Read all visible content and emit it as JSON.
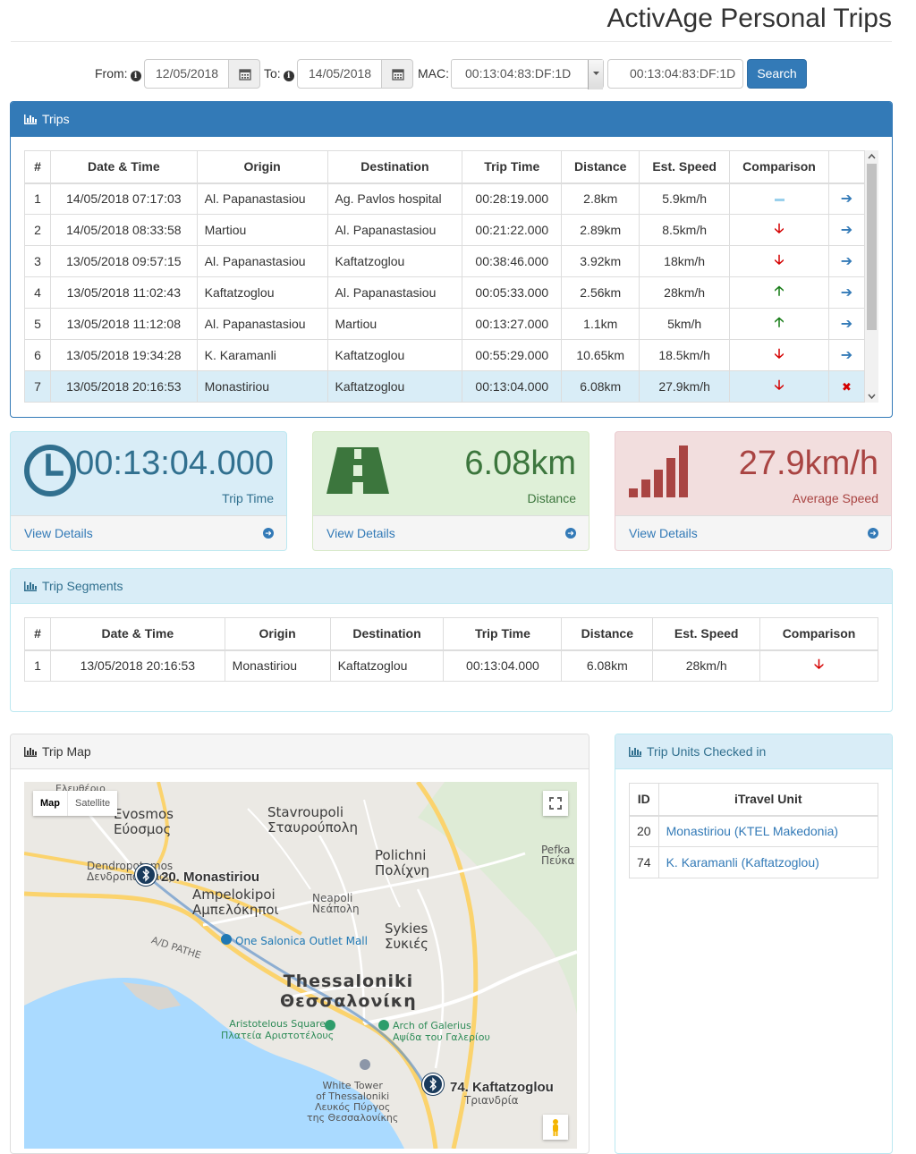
{
  "app": {
    "title": "ActivAge Personal Trips"
  },
  "search": {
    "from_label": "From:",
    "from_value": "12/05/2018",
    "to_label": "To:",
    "to_value": "14/05/2018",
    "mac_label": "MAC:",
    "mac_selected": "00:13:04:83:DF:1D",
    "mac_input_value": "00:13:04:83:DF:1D",
    "search_button": "Search"
  },
  "trips": {
    "title": "Trips",
    "columns": [
      "#",
      "Date & Time",
      "Origin",
      "Destination",
      "Trip Time",
      "Distance",
      "Est. Speed",
      "Comparison",
      ""
    ],
    "rows": [
      {
        "num": "1",
        "datetime": "14/05/2018 07:17:03",
        "origin": "Al. Papanastasiou",
        "destination": "Ag. Pavlos hospital",
        "trip_time": "00:28:19.000",
        "distance": "2.8km",
        "speed": "5.9km/h",
        "comparison": "neutral",
        "action": "arrow-right"
      },
      {
        "num": "2",
        "datetime": "14/05/2018 08:33:58",
        "origin": "Martiou",
        "destination": "Al. Papanastasiou",
        "trip_time": "00:21:22.000",
        "distance": "2.89km",
        "speed": "8.5km/h",
        "comparison": "down",
        "action": "arrow-right"
      },
      {
        "num": "3",
        "datetime": "13/05/2018 09:57:15",
        "origin": "Al. Papanastasiou",
        "destination": "Kaftatzoglou",
        "trip_time": "00:38:46.000",
        "distance": "3.92km",
        "speed": "18km/h",
        "comparison": "down",
        "action": "arrow-right"
      },
      {
        "num": "4",
        "datetime": "13/05/2018 11:02:43",
        "origin": "Kaftatzoglou",
        "destination": "Al. Papanastasiou",
        "trip_time": "00:05:33.000",
        "distance": "2.56km",
        "speed": "28km/h",
        "comparison": "up",
        "action": "arrow-right"
      },
      {
        "num": "5",
        "datetime": "13/05/2018 11:12:08",
        "origin": "Al. Papanastasiou",
        "destination": "Martiou",
        "trip_time": "00:13:27.000",
        "distance": "1.1km",
        "speed": "5km/h",
        "comparison": "up",
        "action": "arrow-right"
      },
      {
        "num": "6",
        "datetime": "13/05/2018 19:34:28",
        "origin": "K. Karamanli",
        "destination": "Kaftatzoglou",
        "trip_time": "00:55:29.000",
        "distance": "10.65km",
        "speed": "18.5km/h",
        "comparison": "down",
        "action": "arrow-right"
      },
      {
        "num": "7",
        "datetime": "13/05/2018 20:16:53",
        "origin": "Monastiriou",
        "destination": "Kaftatzoglou",
        "trip_time": "00:13:04.000",
        "distance": "6.08km",
        "speed": "27.9km/h",
        "comparison": "down",
        "action": "close"
      }
    ]
  },
  "stats": {
    "trip_time": {
      "value": "00:13:04.000",
      "caption": "Trip Time",
      "link": "View Details",
      "icon": "clock-icon",
      "bg": "#d9edf7",
      "border": "#bce8f1",
      "color": "#31708f"
    },
    "distance": {
      "value": "6.08km",
      "caption": "Distance",
      "link": "View Details",
      "icon": "road-icon",
      "bg": "#dff0d8",
      "border": "#d6e9c6",
      "color": "#3c763d"
    },
    "speed": {
      "value": "27.9km/h",
      "caption": "Average Speed",
      "link": "View Details",
      "icon": "signal-bars-icon",
      "bg": "#f2dede",
      "border": "#ebccd1",
      "color": "#a94442"
    }
  },
  "segments": {
    "title": "Trip Segments",
    "columns": [
      "#",
      "Date & Time",
      "Origin",
      "Destination",
      "Trip Time",
      "Distance",
      "Est. Speed",
      "Comparison"
    ],
    "rows": [
      {
        "num": "1",
        "datetime": "13/05/2018 20:16:53",
        "origin": "Monastiriou",
        "destination": "Kaftatzoglou",
        "trip_time": "00:13:04.000",
        "distance": "6.08km",
        "speed": "28km/h",
        "comparison": "down"
      }
    ]
  },
  "map": {
    "title": "Trip Map",
    "type_map": "Map",
    "type_satellite": "Satellite",
    "labels": {
      "evosmos": "Evosmos\nΕύοσμος",
      "stavroupoli": "Stavroupoli\nΣταυρούπολη",
      "polichni": "Polichni\nΠολίχνη",
      "pefka": "Pefka\nΠεύκα",
      "dendropotamos": "Dendropotamos\nΔενδροπόταμος",
      "ampelokipoi": "Ampelokipoi\nΑμπελόκηποι",
      "neapoli": "Neapoli\nΝεάπολη",
      "sykies": "Sykies\nΣυκιές",
      "thessaloniki": "Thessaloniki\nΘεσσαλονίκη",
      "one_salonica": "One Salonica Outlet Mall",
      "aristotelous": "Aristotelous Square\nΠλατεία Αριστοτέλους",
      "galerius": "Arch of Galerius\nΑψίδα του Γαλερίου",
      "white_tower": "White Tower\nof Thessaloniki\nΛευκός Πύργος\nτης Θεσσαλονίκης",
      "triandria": "Τριανδρία",
      "eleftherio": "Ελευθέριο",
      "ad_pathe": "A/D PATHE"
    },
    "markers": [
      {
        "label": "20. Monastiriou",
        "icon": "bluetooth-icon"
      },
      {
        "label": "74. Kaftatzoglou",
        "icon": "bluetooth-icon"
      }
    ]
  },
  "units": {
    "title": "Trip Units Checked in",
    "columns": [
      "ID",
      "iTravel Unit"
    ],
    "rows": [
      {
        "id": "20",
        "name": "Monastiriou (KTEL Makedonia)"
      },
      {
        "id": "74",
        "name": "K. Karamanli (Kaftatzoglou)"
      }
    ]
  }
}
